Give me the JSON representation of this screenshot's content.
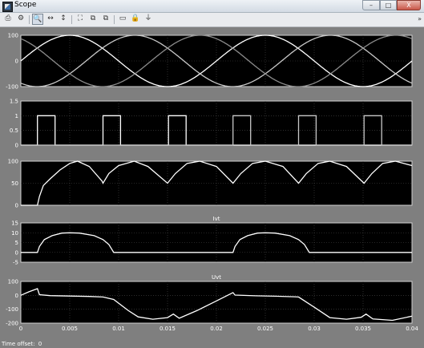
{
  "window": {
    "title": "Scope",
    "controls": {
      "minimize": "–",
      "maximize": "□",
      "close": "X"
    }
  },
  "toolbar": {
    "buttons": [
      {
        "name": "print-icon",
        "glyph": "⎙"
      },
      {
        "name": "parameters-icon",
        "glyph": "⚙"
      },
      {
        "name": "zoom-icon",
        "glyph": "🔍"
      },
      {
        "name": "zoom-x-icon",
        "glyph": "↔"
      },
      {
        "name": "zoom-y-icon",
        "glyph": "↕"
      },
      {
        "name": "autoscale-icon",
        "glyph": "⛶"
      },
      {
        "name": "save-axes-icon",
        "glyph": "⧉"
      },
      {
        "name": "restore-axes-icon",
        "glyph": "⧉"
      },
      {
        "name": "floating-scope-icon",
        "glyph": "▭"
      },
      {
        "name": "lock-icon",
        "glyph": "🔒"
      },
      {
        "name": "signal-selection-icon",
        "glyph": "⏚"
      }
    ],
    "chevron": "»"
  },
  "status": {
    "label": "Time offset:",
    "value": "0"
  },
  "colors": {
    "axes_background": "#000000",
    "figure_background": "#7f7f7f",
    "trace_primary": "#ffffff",
    "trace_secondary": "#c8c8c8",
    "trace_tertiary": "#8c8c8c",
    "text": "#ffffff"
  },
  "chart_data": [
    {
      "type": "line",
      "title": "",
      "xlim": [
        0,
        0.04
      ],
      "ylim": [
        -100,
        100
      ],
      "yticks": [
        "100",
        "0",
        "-100"
      ],
      "grid": true,
      "series": [
        {
          "kind": "sine",
          "amplitude": 100,
          "frequency_hz": 50,
          "phase_deg": 0
        },
        {
          "kind": "sine",
          "amplitude": 100,
          "frequency_hz": 50,
          "phase_deg": -120
        },
        {
          "kind": "sine",
          "amplitude": 100,
          "frequency_hz": 50,
          "phase_deg": 120
        }
      ]
    },
    {
      "type": "line",
      "title": "",
      "xlim": [
        0,
        0.04
      ],
      "ylim": [
        0,
        1.5
      ],
      "yticks": [
        "1.5",
        "1",
        "0.5",
        "0"
      ],
      "grid": true,
      "series": [
        {
          "kind": "pulses",
          "pulses": [
            [
              0.0017,
              0.0035
            ],
            [
              0.0084,
              0.0102
            ],
            [
              0.0151,
              0.0169
            ]
          ]
        },
        {
          "kind": "pulses",
          "pulses": [
            [
              0.0217,
              0.0235
            ],
            [
              0.0284,
              0.0302
            ],
            [
              0.0351,
              0.0369
            ]
          ]
        }
      ]
    },
    {
      "type": "line",
      "title": "",
      "xlim": [
        0,
        0.04
      ],
      "ylim": [
        0,
        100
      ],
      "yticks": [
        "100",
        "50",
        "0"
      ],
      "grid": true,
      "series": [
        {
          "kind": "rectified",
          "points": [
            [
              0,
              0
            ],
            [
              0.0017,
              0
            ],
            [
              0.0019,
              20
            ],
            [
              0.0023,
              45
            ],
            [
              0.003,
              60
            ],
            [
              0.004,
              80
            ],
            [
              0.005,
              95
            ],
            [
              0.0058,
              100
            ],
            [
              0.007,
              88
            ],
            [
              0.0083,
              55
            ],
            [
              0.0084,
              50
            ],
            [
              0.009,
              72
            ],
            [
              0.01,
              90
            ],
            [
              0.0116,
              100
            ],
            [
              0.013,
              88
            ],
            [
              0.015,
              50
            ],
            [
              0.0158,
              72
            ],
            [
              0.017,
              95
            ],
            [
              0.0183,
              100
            ],
            [
              0.02,
              88
            ],
            [
              0.0217,
              50
            ],
            [
              0.0225,
              72
            ],
            [
              0.0237,
              95
            ],
            [
              0.025,
              100
            ],
            [
              0.0268,
              88
            ],
            [
              0.0284,
              50
            ],
            [
              0.0292,
              72
            ],
            [
              0.0304,
              95
            ],
            [
              0.0316,
              100
            ],
            [
              0.0333,
              88
            ],
            [
              0.0351,
              50
            ],
            [
              0.0359,
              72
            ],
            [
              0.037,
              95
            ],
            [
              0.0383,
              100
            ],
            [
              0.04,
              90
            ]
          ]
        }
      ]
    },
    {
      "type": "line",
      "title": "Ivt",
      "xlim": [
        0,
        0.04
      ],
      "ylim": [
        -5,
        15
      ],
      "yticks": [
        "15",
        "10",
        "5",
        "0",
        "-5"
      ],
      "grid": true,
      "series": [
        {
          "kind": "current",
          "points": [
            [
              0,
              0
            ],
            [
              0.0017,
              0
            ],
            [
              0.0019,
              3
            ],
            [
              0.0024,
              6.5
            ],
            [
              0.0032,
              8.5
            ],
            [
              0.0042,
              9.8
            ],
            [
              0.005,
              10
            ],
            [
              0.006,
              9.8
            ],
            [
              0.0075,
              8.5
            ],
            [
              0.0084,
              6.5
            ],
            [
              0.009,
              4
            ],
            [
              0.0095,
              0
            ],
            [
              0.0217,
              0
            ],
            [
              0.0219,
              3
            ],
            [
              0.0224,
              6.5
            ],
            [
              0.0232,
              8.5
            ],
            [
              0.0242,
              9.8
            ],
            [
              0.025,
              10
            ],
            [
              0.026,
              9.8
            ],
            [
              0.0275,
              8.5
            ],
            [
              0.0284,
              6.5
            ],
            [
              0.029,
              4
            ],
            [
              0.0295,
              0
            ],
            [
              0.04,
              0
            ]
          ]
        }
      ]
    },
    {
      "type": "line",
      "title": "Uvt",
      "xlim": [
        0,
        0.04
      ],
      "ylim": [
        -200,
        100
      ],
      "yticks": [
        "100",
        "0",
        "-100",
        "-200"
      ],
      "xticks": [
        "0",
        "0.005",
        "0.01",
        "0.015",
        "0.02",
        "0.025",
        "0.03",
        "0.035",
        "0.04"
      ],
      "grid": true,
      "series": [
        {
          "kind": "voltage",
          "points": [
            [
              0,
              0
            ],
            [
              0.0008,
              25
            ],
            [
              0.0017,
              48
            ],
            [
              0.0019,
              5
            ],
            [
              0.003,
              -2
            ],
            [
              0.005,
              -5
            ],
            [
              0.007,
              -8
            ],
            [
              0.0084,
              -12
            ],
            [
              0.0095,
              -30
            ],
            [
              0.011,
              -110
            ],
            [
              0.012,
              -155
            ],
            [
              0.0135,
              -172
            ],
            [
              0.015,
              -160
            ],
            [
              0.0156,
              -135
            ],
            [
              0.0162,
              -165
            ],
            [
              0.018,
              -110
            ],
            [
              0.02,
              -40
            ],
            [
              0.021,
              -5
            ],
            [
              0.0217,
              20
            ],
            [
              0.0219,
              2
            ],
            [
              0.024,
              -3
            ],
            [
              0.026,
              -6
            ],
            [
              0.028,
              -10
            ],
            [
              0.0284,
              -12
            ],
            [
              0.03,
              -85
            ],
            [
              0.0316,
              -160
            ],
            [
              0.0333,
              -172
            ],
            [
              0.0348,
              -158
            ],
            [
              0.0353,
              -135
            ],
            [
              0.036,
              -170
            ],
            [
              0.038,
              -180
            ],
            [
              0.04,
              -150
            ]
          ]
        }
      ]
    }
  ]
}
